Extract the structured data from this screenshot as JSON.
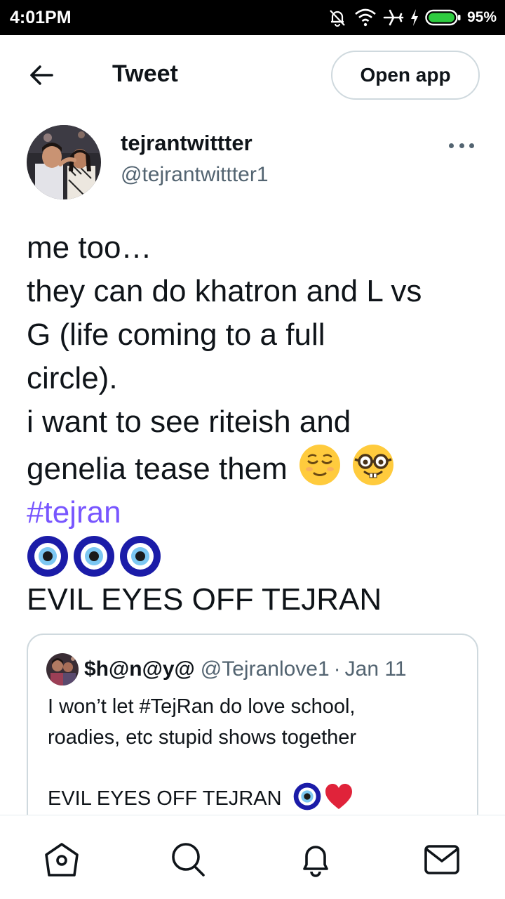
{
  "status_bar": {
    "time": "4:01PM",
    "battery_percent": "95%",
    "icons": [
      "notifications-off-icon",
      "wifi-icon",
      "airplane-icon",
      "charging-icon",
      "battery-icon"
    ]
  },
  "header": {
    "title": "Tweet",
    "open_app_label": "Open app",
    "back_icon": "arrow-left-icon"
  },
  "tweet": {
    "author_name": "tejrantwittter",
    "author_handle": "@tejrantwittter1",
    "more_icon": "more-dots-icon",
    "lines": {
      "l1": "me too…",
      "l2": "they can do khatron and L vs",
      "l3": "G (life coming to a full",
      "l4": "circle).",
      "l5": "i want to see riteish and",
      "l6": "genelia tease them",
      "hashtag": "#tejran",
      "l8": "EVIL EYES OFF TEJRAN"
    },
    "emojis": [
      "relieved-face-emoji",
      "nerd-face-emoji",
      "nazar-amulet-emoji",
      "nazar-amulet-emoji",
      "nazar-amulet-emoji"
    ]
  },
  "quote": {
    "name": "$h@n@y@",
    "handle": "@Tejranlove1",
    "separator": "·",
    "date": "Jan 11",
    "line1": "I won’t let #TejRan do love school,",
    "line2": "roadies, etc stupid shows together",
    "line3": "EVIL EYES OFF TEJRAN",
    "emojis": [
      "nazar-amulet-emoji",
      "red-heart-emoji"
    ]
  },
  "bottom_nav": [
    "home-icon",
    "search-icon",
    "notifications-icon",
    "messages-icon"
  ],
  "colors": {
    "text": "#0f1419",
    "secondary_text": "#536471",
    "hashtag": "#7856ff",
    "border": "#cfd9de",
    "status_bar_bg": "#000000",
    "battery_green": "#2ecc40"
  }
}
